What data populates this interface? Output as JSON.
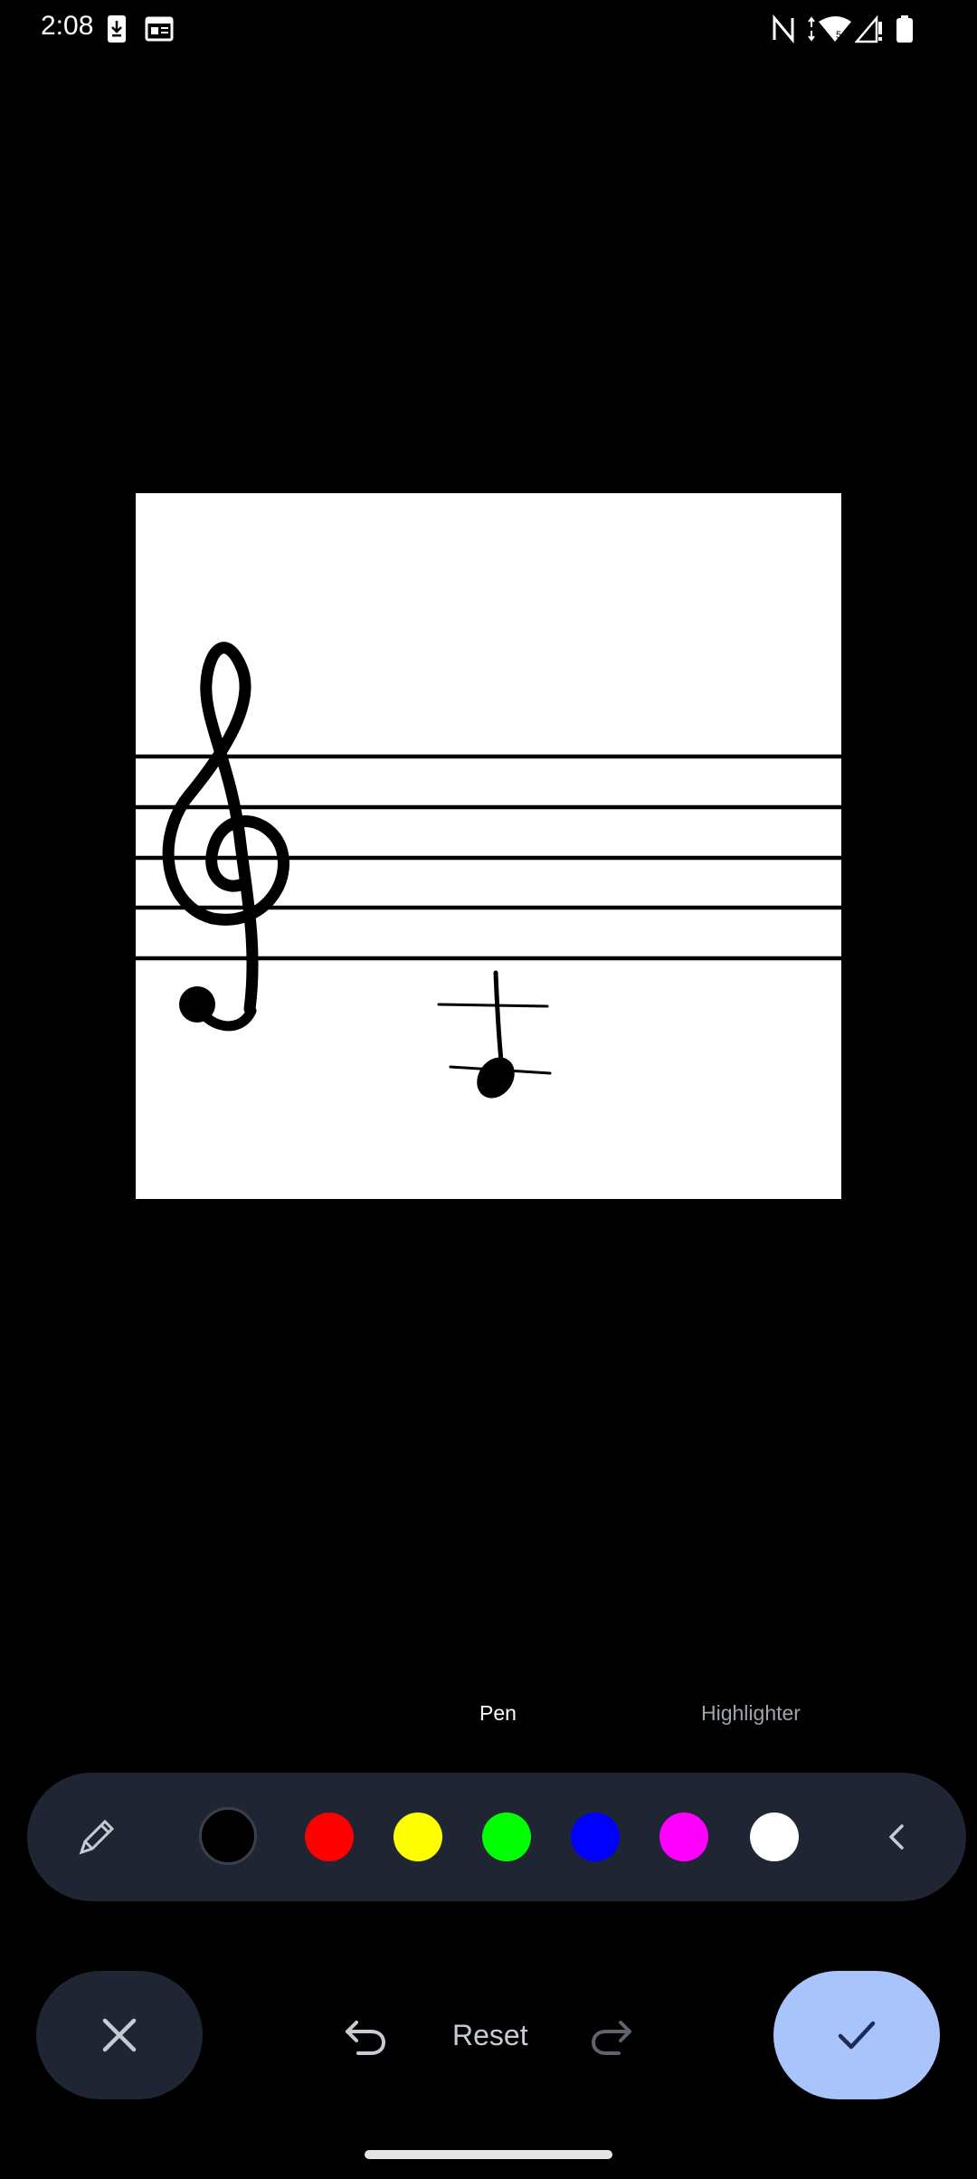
{
  "status_bar": {
    "time": "2:08",
    "left_icons": [
      "download-icon",
      "calendar-icon"
    ],
    "right_icons": [
      "nfc-icon",
      "wifi-icon",
      "signal-icon",
      "battery-icon"
    ]
  },
  "editor": {
    "tabs": [
      {
        "label": "Pen",
        "selected": true
      },
      {
        "label": "Highlighter",
        "selected": false
      }
    ],
    "colors": [
      {
        "name": "black",
        "hex": "#000000",
        "selected": true
      },
      {
        "name": "red",
        "hex": "#ff0000",
        "selected": false
      },
      {
        "name": "yellow",
        "hex": "#ffff00",
        "selected": false
      },
      {
        "name": "green",
        "hex": "#00ff00",
        "selected": false
      },
      {
        "name": "blue",
        "hex": "#0000ff",
        "selected": false
      },
      {
        "name": "magenta",
        "hex": "#ff00ff",
        "selected": false
      },
      {
        "name": "white",
        "hex": "#ffffff",
        "selected": false
      }
    ],
    "reset_label": "Reset"
  },
  "theme": {
    "toolbar_bg": "#202534",
    "confirm_bg": "#a9c4fb",
    "confirm_icon": "#1b2a57"
  }
}
